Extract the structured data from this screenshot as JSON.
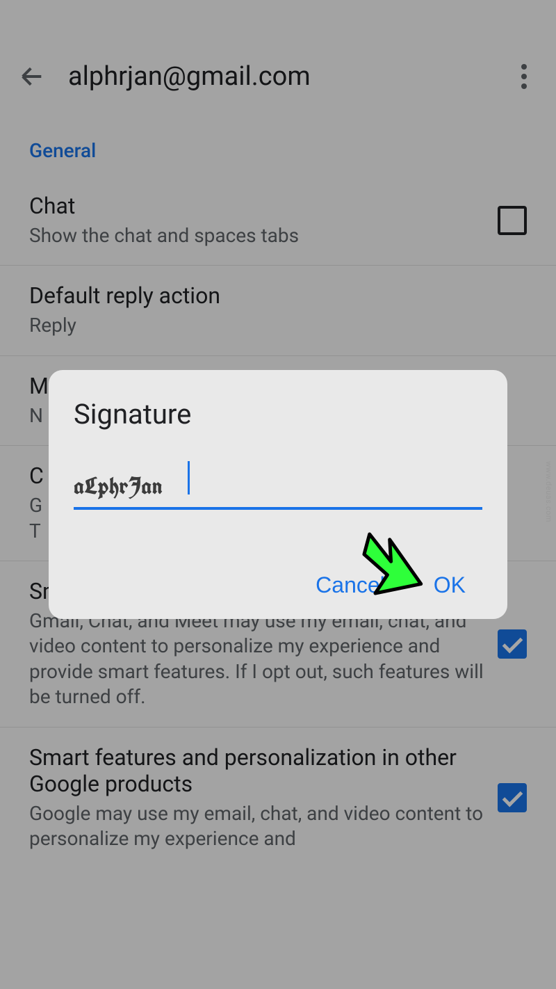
{
  "header": {
    "title": "alphrjan@gmail.com"
  },
  "section_label": "General",
  "settings": {
    "chat": {
      "title": "Chat",
      "sub": "Show the chat and spaces tabs",
      "checked": false
    },
    "reply": {
      "title": "Default reply action",
      "sub": "Reply"
    },
    "m_item": {
      "title": "M",
      "sub": "N"
    },
    "c_item": {
      "title": "C",
      "sub": "G\nT"
    },
    "smart1": {
      "title": "Smart features and personalization",
      "sub": "Gmail, Chat, and Meet may use my email, chat, and video content to personalize my experience and provide smart features. If I opt out, such features will be turned off.",
      "checked": true
    },
    "smart2": {
      "title": "Smart features and personalization in other Google products",
      "sub": "Google may use my email, chat, and video content to personalize my experience and",
      "checked": true
    }
  },
  "dialog": {
    "title": "Signature",
    "input_value": "aLphrJan",
    "cancel": "Cancel",
    "ok": "OK"
  },
  "watermark": "www.deuas.com"
}
